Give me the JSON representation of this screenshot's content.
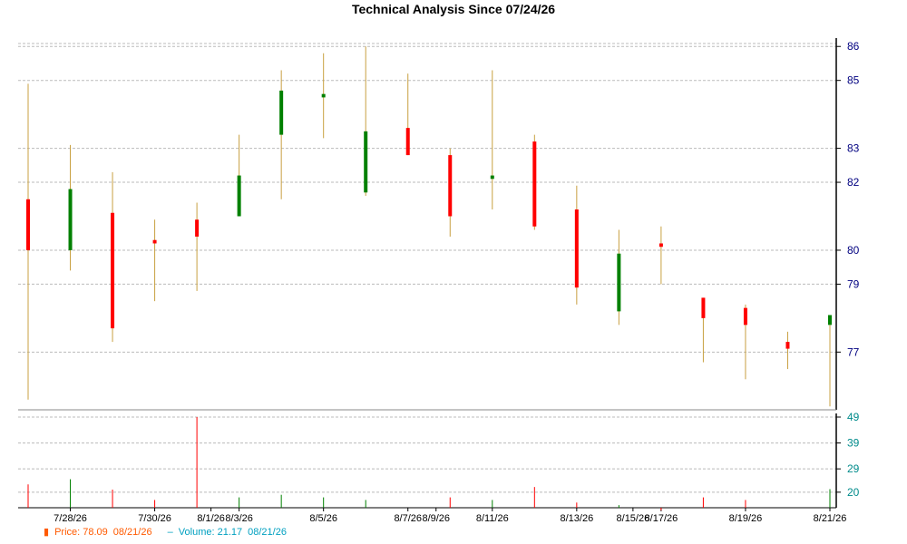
{
  "chart_data": {
    "type": "candlestick",
    "title": "Technical Analysis Since 07/24/26",
    "price_axis": {
      "ylim": [
        75.3,
        86.3
      ],
      "ticks": [
        77,
        79,
        80,
        82,
        83,
        85,
        86
      ]
    },
    "volume_axis": {
      "ylim": [
        14,
        49
      ],
      "ticks": [
        20,
        29,
        39,
        49
      ]
    },
    "x_ticks": [
      "7/28/26",
      "7/30/26",
      "8/1/26",
      "8/3/26",
      "8/5/26",
      "8/7/26",
      "8/9/26",
      "8/11/26",
      "8/13/26",
      "8/15/26",
      "8/17/26",
      "8/19/26",
      "8/21/26"
    ],
    "grid": true,
    "candles": [
      {
        "date": "7/27/26",
        "open": 81.5,
        "high": 84.9,
        "low": 75.6,
        "close": 80.0,
        "volume": 23
      },
      {
        "date": "7/28/26",
        "open": 80.0,
        "high": 83.1,
        "low": 79.4,
        "close": 81.8,
        "volume": 25
      },
      {
        "date": "7/29/26",
        "open": 81.1,
        "high": 82.3,
        "low": 77.3,
        "close": 77.7,
        "volume": 21
      },
      {
        "date": "7/30/26",
        "open": 80.3,
        "high": 80.9,
        "low": 78.5,
        "close": 80.2,
        "volume": 17
      },
      {
        "date": "7/31/26",
        "open": 80.9,
        "high": 81.4,
        "low": 78.8,
        "close": 80.4,
        "volume": 49
      },
      {
        "date": "8/3/26",
        "open": 81.0,
        "high": 83.4,
        "low": 81.0,
        "close": 82.2,
        "volume": 18
      },
      {
        "date": "8/4/26",
        "open": 83.4,
        "high": 85.3,
        "low": 81.5,
        "close": 84.7,
        "volume": 19
      },
      {
        "date": "8/5/26",
        "open": 84.5,
        "high": 85.8,
        "low": 83.3,
        "close": 84.6,
        "volume": 18
      },
      {
        "date": "8/6/26",
        "open": 81.7,
        "high": 86.0,
        "low": 81.6,
        "close": 83.5,
        "volume": 17
      },
      {
        "date": "8/7/26",
        "open": 83.6,
        "high": 85.2,
        "low": 82.8,
        "close": 82.8,
        "volume": 14
      },
      {
        "date": "8/10/26",
        "open": 82.8,
        "high": 83.0,
        "low": 80.4,
        "close": 81.0,
        "volume": 18
      },
      {
        "date": "8/11/26",
        "open": 82.1,
        "high": 85.3,
        "low": 81.2,
        "close": 82.2,
        "volume": 17
      },
      {
        "date": "8/12/26",
        "open": 83.2,
        "high": 83.4,
        "low": 80.6,
        "close": 80.7,
        "volume": 22
      },
      {
        "date": "8/13/26",
        "open": 81.2,
        "high": 81.9,
        "low": 78.4,
        "close": 78.9,
        "volume": 16
      },
      {
        "date": "8/14/26",
        "open": 78.2,
        "high": 80.6,
        "low": 77.8,
        "close": 79.9,
        "volume": 15
      },
      {
        "date": "8/17/26",
        "open": 80.2,
        "high": 80.7,
        "low": 79.0,
        "close": 80.1,
        "volume": 13
      },
      {
        "date": "8/18/26",
        "open": 78.6,
        "high": 78.6,
        "low": 76.7,
        "close": 78.0,
        "volume": 18
      },
      {
        "date": "8/19/26",
        "open": 78.3,
        "high": 78.4,
        "low": 76.2,
        "close": 77.8,
        "volume": 17
      },
      {
        "date": "8/20/26",
        "open": 77.3,
        "high": 77.6,
        "low": 76.5,
        "close": 77.1,
        "volume": 14
      },
      {
        "date": "8/21/26",
        "open": 77.8,
        "high": 77.8,
        "low": 75.4,
        "close": 78.09,
        "volume": 21.17
      }
    ],
    "colors": {
      "up": "#008000",
      "down": "#ff0000",
      "wick": "#c8a040",
      "grid": "#bbbbbb",
      "axis": "#000000",
      "tick_label": "#000080",
      "volume_tick_label": "#008b8b"
    }
  },
  "legend": {
    "price": "Price: 78.09",
    "price_date": "08/21/26",
    "volume": "Volume: 21.17",
    "volume_date": "08/21/26",
    "price_color": "#ff5a00",
    "volume_color": "#00a0c0"
  }
}
